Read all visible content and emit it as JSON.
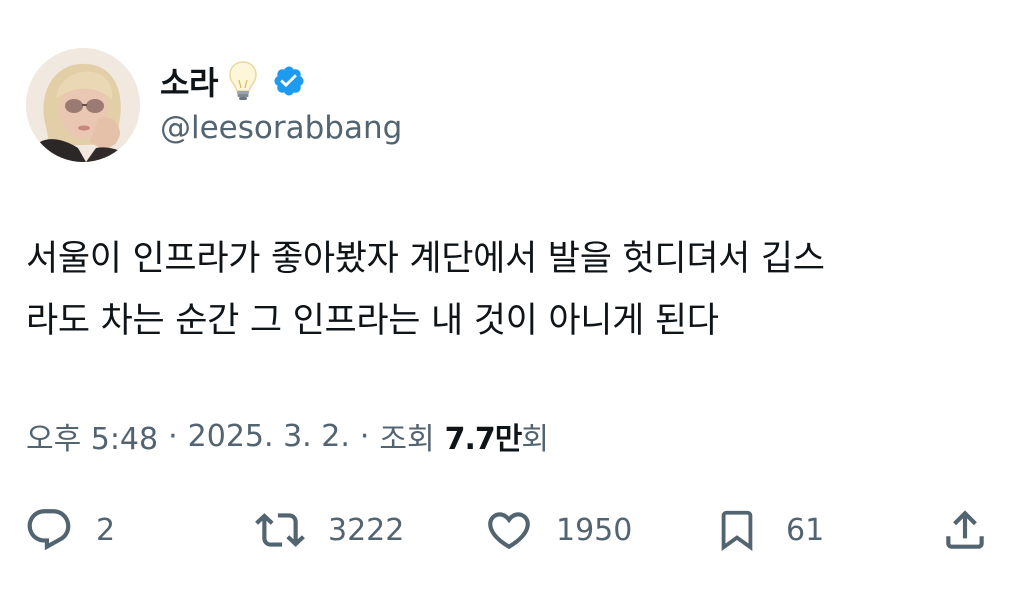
{
  "author": {
    "display_name": "소라",
    "handle": "@leesorabbang",
    "badge_icon": "verified-badge-icon",
    "emoji_icon": "light-bulb-icon",
    "verified_color": "#1d9bf0"
  },
  "tweet": {
    "text": "서울이 인프라가 좋아봤자 계단에서 발을 헛디뎌서 깁스\n라도 차는 순간 그 인프라는 내 것이 아니게 된다"
  },
  "meta": {
    "time": "오후 5:48",
    "separator": "·",
    "date": "2025. 3. 2.",
    "views_prefix": "조회",
    "views_count": "7.7만",
    "views_suffix": "회"
  },
  "actions": {
    "reply": {
      "icon": "reply-icon",
      "count": "2"
    },
    "retweet": {
      "icon": "retweet-icon",
      "count": "3222"
    },
    "like": {
      "icon": "heart-icon",
      "count": "1950"
    },
    "bookmark": {
      "icon": "bookmark-icon",
      "count": "61"
    },
    "share": {
      "icon": "share-icon"
    }
  },
  "colors": {
    "text_primary": "#0f1419",
    "text_secondary": "#536471",
    "accent": "#1d9bf0"
  }
}
